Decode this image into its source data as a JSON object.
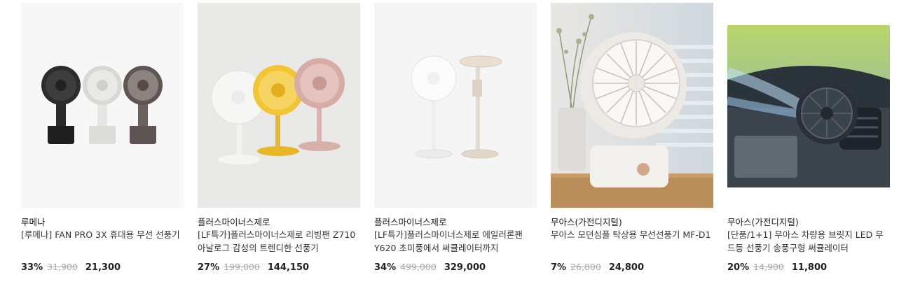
{
  "products": [
    {
      "brand": "루메나",
      "name": "[루메나] FAN PRO 3X 휴대용 무선 선풍기",
      "discount": "33%",
      "original_price": "31,900",
      "sale_price": "21,300",
      "bg_color": "#f7f7f7"
    },
    {
      "brand": "플러스마이너스제로",
      "name": "[LF특가]플러스마이너스제로 리빙팬 Z710 아날로그 감성의 트렌디한 선풍기",
      "discount": "27%",
      "original_price": "199,000",
      "sale_price": "144,150",
      "bg_color": "#e9e9e7"
    },
    {
      "brand": "플러스마이너스제로",
      "name": "[LF특가]플러스마이너스제로 에일러론팬 Y620 초미풍에서 써큘레이터까지",
      "discount": "34%",
      "original_price": "499,000",
      "sale_price": "329,000",
      "bg_color": "#f5f5f5"
    },
    {
      "brand": "무아스(가전디지털)",
      "name": "무아스 모던심플 탁상용 무선선풍기 MF-D1",
      "discount": "7%",
      "original_price": "26,800",
      "sale_price": "24,800",
      "bg_color": "#e8e4e0"
    },
    {
      "brand": "무아스(가전디지털)",
      "name": "[단품/1+1] 무아스 차량용 브릿지 LED 무드등 선풍기 송풍구형 써큘레이터",
      "discount": "20%",
      "original_price": "14,900",
      "sale_price": "11,800",
      "bg_color": "#cfd6dc"
    }
  ]
}
